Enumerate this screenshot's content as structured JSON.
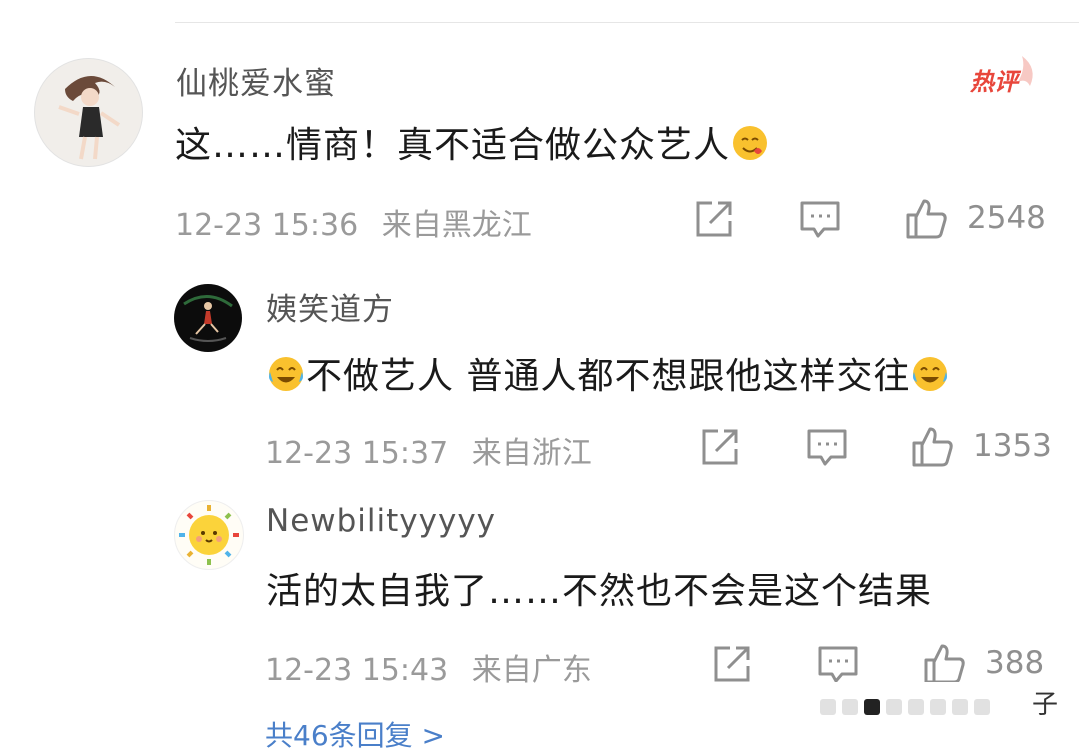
{
  "comments": [
    {
      "user": "仙桃爱水蜜",
      "badge": "热评",
      "text": "这……情商！真不适合做公众艺人",
      "emoji": "smile-heart-emoji",
      "time": "12-23 15:36",
      "location": "来自黑龙江",
      "likes": "2548"
    },
    {
      "user": "姨笑道方",
      "text": "不做艺人 普通人都不想跟他这样交往",
      "emoji": "laugh-cry-emoji",
      "time": "12-23 15:37",
      "location": "来自浙江",
      "likes": "1353"
    },
    {
      "user": "Newbilityyyyy",
      "text": "活的太自我了……不然也不会是这个结果",
      "time": "12-23 15:43",
      "location": "来自广东",
      "likes": "388"
    }
  ],
  "more_replies": "共46条回复 >",
  "toolbar_char": "子",
  "colors": {
    "accent": "#e8463b",
    "link": "#4a7fc9",
    "muted": "#9a9a9a"
  }
}
